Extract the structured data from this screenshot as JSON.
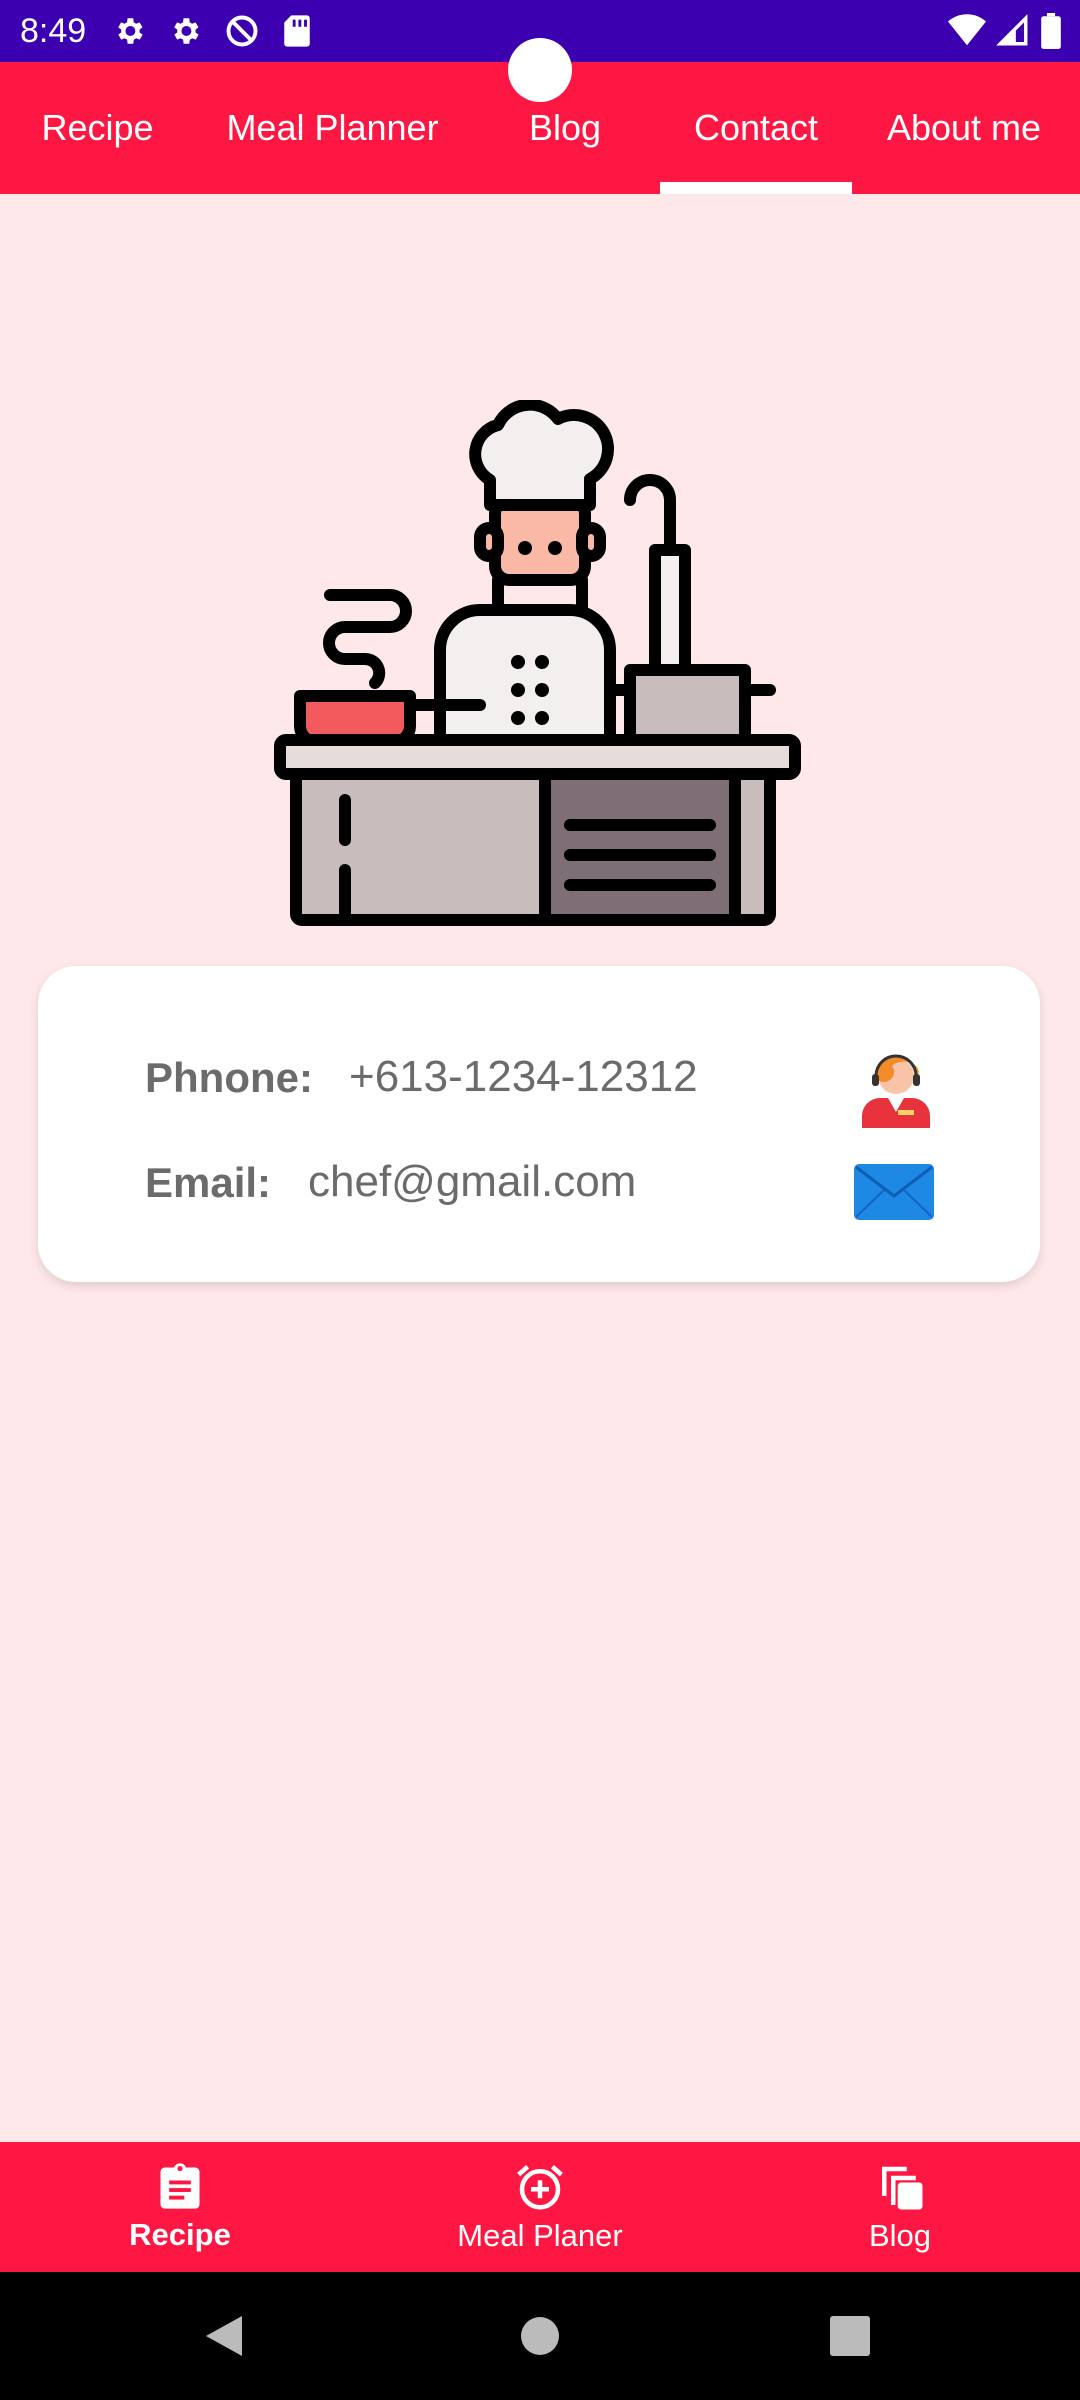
{
  "status_bar": {
    "time": "8:49",
    "icons": [
      "gear-icon",
      "gear-icon",
      "do-not-disturb-icon",
      "sd-card-icon",
      "wifi-icon",
      "signal-icon",
      "battery-icon"
    ]
  },
  "top_tabs": {
    "items": [
      {
        "label": "Recipe",
        "selected": false
      },
      {
        "label": "Meal Planner",
        "selected": false
      },
      {
        "label": "Blog",
        "selected": false
      },
      {
        "label": "Contact",
        "selected": true
      },
      {
        "label": "About me",
        "selected": false
      }
    ]
  },
  "contact": {
    "phone_label": "Phnone:",
    "phone_value": "+613-1234-12312",
    "email_label": "Email:",
    "email_value": "chef@gmail.com",
    "phone_icon": "support-agent-icon",
    "email_icon": "envelope-icon"
  },
  "bottom_nav": {
    "items": [
      {
        "label": "Recipe",
        "icon": "clipboard-icon",
        "active": true
      },
      {
        "label": "Meal Planer",
        "icon": "alarm-add-icon",
        "active": false
      },
      {
        "label": "Blog",
        "icon": "copy-icon",
        "active": false
      }
    ]
  },
  "colors": {
    "status_bar": "#3D00B0",
    "accent": "#FF1744",
    "background": "#FFE8EA",
    "card": "#FFFFFF"
  }
}
